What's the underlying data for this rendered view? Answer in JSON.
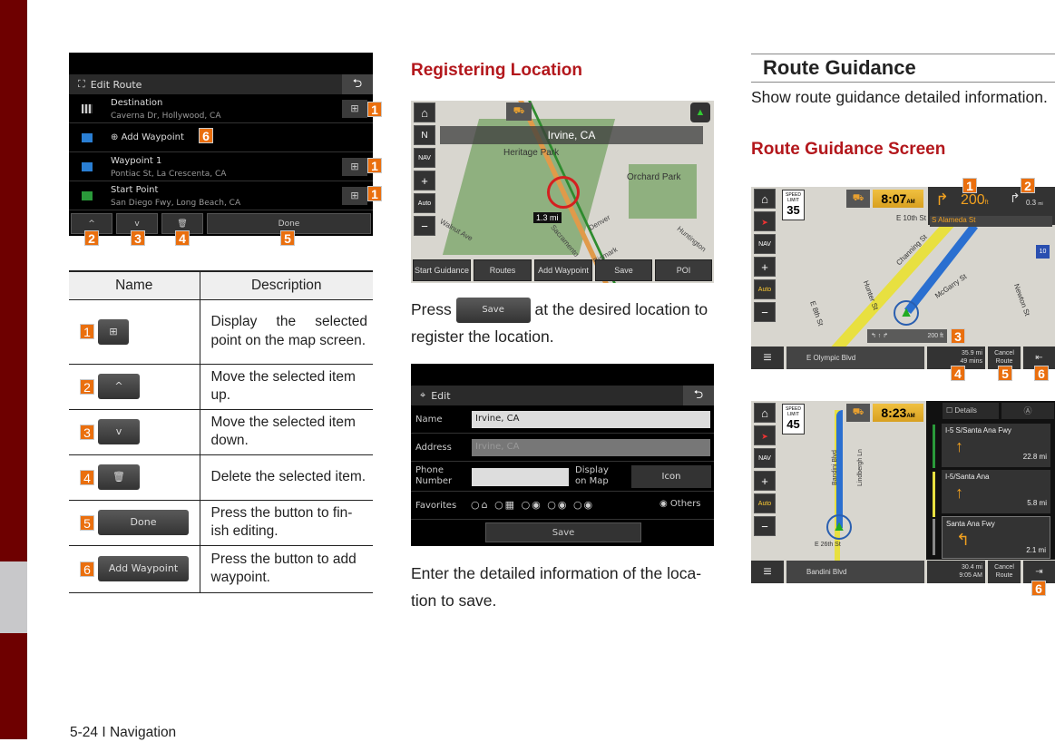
{
  "footer": {
    "page": "5-24 I Navigation"
  },
  "edit_route": {
    "title": "Edit Route",
    "rows": [
      {
        "name": "Destination",
        "addr": "Caverna Dr, Hollywood, CA"
      },
      {
        "name": "Add Waypoint"
      },
      {
        "name": "Waypoint 1",
        "addr": "Pontiac St, La Crescenta, CA"
      },
      {
        "name": "Start Point",
        "addr": "San Diego Fwy, Long Beach, CA"
      }
    ],
    "buttons": {
      "up": "^",
      "down": "v",
      "delete": "🗑",
      "done": "Done"
    },
    "badges": [
      "1",
      "2",
      "3",
      "4",
      "5",
      "6"
    ]
  },
  "table": {
    "headers": [
      "Name",
      "Description"
    ],
    "rows": [
      {
        "num": "1",
        "btn": "⊞",
        "desc": "Display the selected point on the map screen."
      },
      {
        "num": "2",
        "btn": "^",
        "desc": "Move the selected item up."
      },
      {
        "num": "3",
        "btn": "v",
        "desc": "Move the selected item down."
      },
      {
        "num": "4",
        "btn": "🗑",
        "desc": "Delete the selected item."
      },
      {
        "num": "5",
        "btn": "Done",
        "desc": "Press the button to fin-ish editing."
      },
      {
        "num": "6",
        "btn": "Add Waypoint",
        "desc": "Press the button to add waypoint."
      }
    ]
  },
  "registering": {
    "title": "Registering Location",
    "map": {
      "location": "Irvine, CA",
      "park1": "Heritage Park",
      "park2": "Orchard Park",
      "scale": "1.3 mi",
      "streets": [
        "Walnut Ave",
        "Sacramento",
        "Denver",
        "Bismark",
        "Huntington"
      ],
      "buttons": [
        "Start Guidance",
        "Routes",
        "Add Waypoint",
        "Save",
        "POI"
      ]
    },
    "text_before": "Press",
    "save_btn": "Save",
    "text_after": "at the desired location to register the location.",
    "edit": {
      "title": "Edit",
      "name_label": "Name",
      "name_value": "Irvine, CA",
      "address_label": "Address",
      "address_value": "Irvine, CA",
      "phone_label": "Phone Number",
      "display_label": "Display on Map",
      "icon_btn": "Icon",
      "favorites_label": "Favorites",
      "others": "Others",
      "save": "Save"
    },
    "text2": "Enter the detailed information of the loca-tion to save."
  },
  "route_guidance": {
    "title": "Route Guidance",
    "desc": "Show route guidance detailed information.",
    "screen_title": "Route Guidance Screen",
    "screen1": {
      "speed_label": "SPEED LIMIT",
      "speed": "35",
      "time": "8:07",
      "ampm": "AM",
      "dist1": "200",
      "dist1_unit": "ft",
      "dist2": "0.3",
      "dist2_unit": "mi",
      "street": "S Alameda St",
      "lane_dist": "200 ft",
      "road": "E Olympic Blvd",
      "remain_dist": "35.9 mi",
      "remain_time": "49 mins",
      "cancel": "Cancel Route",
      "streets": [
        "E 10th St",
        "Channing St",
        "Hunter St",
        "McGarry St",
        "E 8th St",
        "Newton St"
      ],
      "interstate": "10",
      "badges": [
        "1",
        "2",
        "3",
        "4",
        "5",
        "6"
      ]
    },
    "screen2": {
      "speed_label": "SPEED LIMIT",
      "speed": "45",
      "time": "8:23",
      "ampm": "AM",
      "details": "Details",
      "list": [
        {
          "road": "I-5 S/Santa Ana Fwy",
          "dist": "22.8 mi"
        },
        {
          "road": "I-5/Santa Ana",
          "dist": "5.8 mi"
        },
        {
          "road": "Santa Ana Fwy",
          "dist": "2.1 mi"
        }
      ],
      "road": "Bandini Blvd",
      "remain_dist": "30.4 mi",
      "remain_time": "9:05 AM",
      "cancel": "Cancel Route",
      "streets": [
        "Bandini Blvd",
        "Lindbergh Ln",
        "E 26th St"
      ],
      "interstate": "710",
      "badge": "6"
    }
  },
  "colors": {
    "accent": "#b3171c",
    "badge": "#ea6f0e",
    "sidebar": "#6e0000"
  }
}
